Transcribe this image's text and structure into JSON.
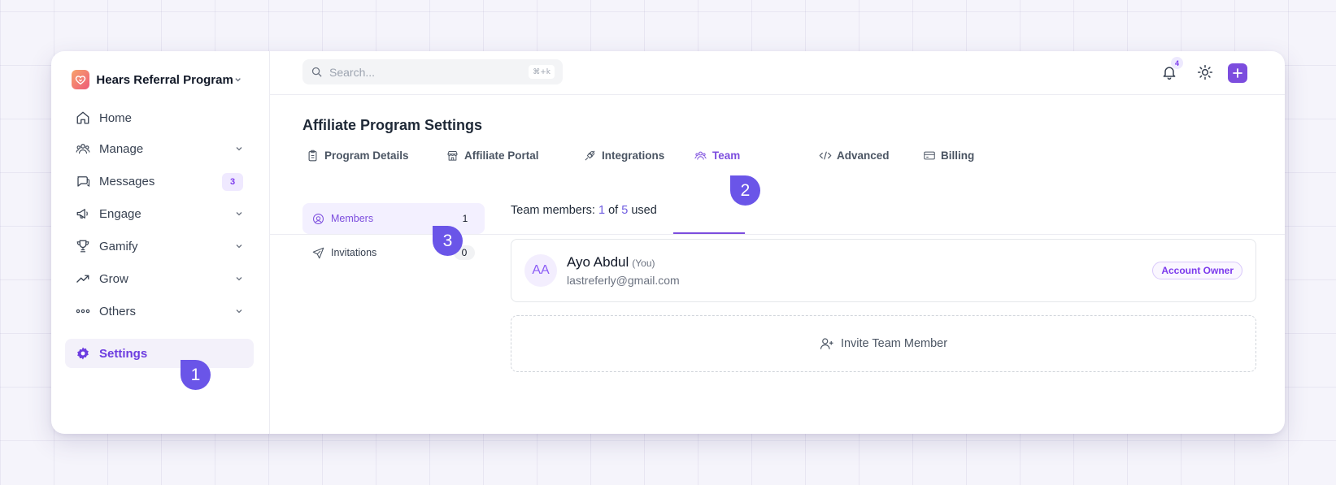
{
  "brand": {
    "name": "Hears Referral Program"
  },
  "sidebar": {
    "items": [
      {
        "label": "Home",
        "icon": "home-icon"
      },
      {
        "label": "Manage",
        "icon": "users-icon"
      },
      {
        "label": "Messages",
        "icon": "chat-icon",
        "badge": "3"
      },
      {
        "label": "Engage",
        "icon": "megaphone-icon"
      },
      {
        "label": "Gamify",
        "icon": "trophy-icon"
      },
      {
        "label": "Grow",
        "icon": "trending-up-icon"
      },
      {
        "label": "Others",
        "icon": "more-dots-icon"
      },
      {
        "label": "Settings",
        "icon": "gear-icon",
        "active": true
      }
    ]
  },
  "search": {
    "placeholder": "Search...",
    "shortcut": "⌘+k"
  },
  "topbar": {
    "notification_count": "4"
  },
  "page": {
    "title": "Affiliate Program Settings"
  },
  "tabs": [
    {
      "label": "Program Details",
      "icon": "clipboard-icon"
    },
    {
      "label": "Affiliate Portal",
      "icon": "storefront-icon"
    },
    {
      "label": "Integrations",
      "icon": "plug-icon"
    },
    {
      "label": "Team",
      "icon": "team-icon",
      "active": true
    },
    {
      "label": "Advanced",
      "icon": "code-icon"
    },
    {
      "label": "Billing",
      "icon": "card-icon"
    }
  ],
  "team": {
    "subnav": [
      {
        "label": "Members",
        "count": "1"
      },
      {
        "label": "Invitations",
        "count": "0"
      }
    ],
    "summary": {
      "prefix": "Team members:",
      "used": "1",
      "of": "of",
      "total": "5",
      "suffix": "used"
    },
    "member": {
      "initials": "AA",
      "name": "Ayo Abdul",
      "you_tag": "(You)",
      "email": "lastreferly@gmail.com",
      "role": "Account Owner"
    },
    "invite_label": "Invite Team Member"
  },
  "markers": [
    "1",
    "2",
    "3"
  ],
  "colors": {
    "accent": "#7c4dde",
    "marker": "#6a55e8",
    "brand_gradient": [
      "#f7a36b",
      "#ee5a78"
    ]
  }
}
